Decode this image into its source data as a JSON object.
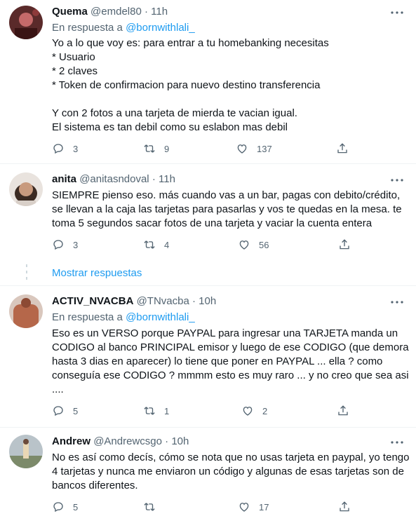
{
  "tweets": [
    {
      "name": "Quema",
      "handle": "@emdel80",
      "time": "11h",
      "reply_prefix": "En respuesta a",
      "reply_to": "@bornwithlali_",
      "text": "Yo a lo que voy es: para entrar a tu homebanking necesitas\n* Usuario\n* 2 claves\n* Token de confirmacion para nuevo destino transferencia\n\nY con 2 fotos a una tarjeta de mierda te vacian igual.\nEl sistema es tan debil como su eslabon mas debil",
      "replies": "3",
      "retweets": "9",
      "likes": "137"
    },
    {
      "name": "anita",
      "handle": "@anitasndoval",
      "time": "11h",
      "text": "SIEMPRE pienso eso. más cuando vas a un bar, pagas con debito/crédito, se llevan a la caja las tarjetas para pasarlas y vos te quedas en la mesa. te toma 5 segundos sacar fotos de una tarjeta y vaciar la cuenta entera",
      "replies": "3",
      "retweets": "4",
      "likes": "56"
    },
    {
      "name": "ACTIV_NVACBA",
      "handle": "@TNvacba",
      "time": "10h",
      "reply_prefix": "En respuesta a",
      "reply_to": "@bornwithlali_",
      "text": "Eso es un VERSO porque PAYPAL para ingresar una TARJETA manda un CODIGO al banco PRINCIPAL emisor y luego de ese CODIGO (que demora hasta 3 dias en aparecer) lo tiene que poner en PAYPAL ... ella ? como conseguía ese CODIGO ? mmmm esto es muy raro ... y no creo que sea asi ....",
      "replies": "5",
      "retweets": "1",
      "likes": "2"
    },
    {
      "name": "Andrew",
      "handle": "@Andrewcsgo",
      "time": "10h",
      "text": "No es así como decís, cómo se nota que no usas tarjeta en paypal, yo tengo  4 tarjetas y nunca me enviaron un código y algunas de esas tarjetas son de bancos diferentes.",
      "replies": "5",
      "retweets": "",
      "likes": "17"
    }
  ],
  "show_replies": "Mostrar respuestas",
  "separator": "·",
  "icons": [
    "reply-icon",
    "retweet-icon",
    "like-icon",
    "share-icon",
    "more-icon"
  ],
  "colors": {
    "link": "#1d9bf0",
    "secondary": "#536471",
    "text": "#0f1419",
    "border": "#eff3f4"
  }
}
